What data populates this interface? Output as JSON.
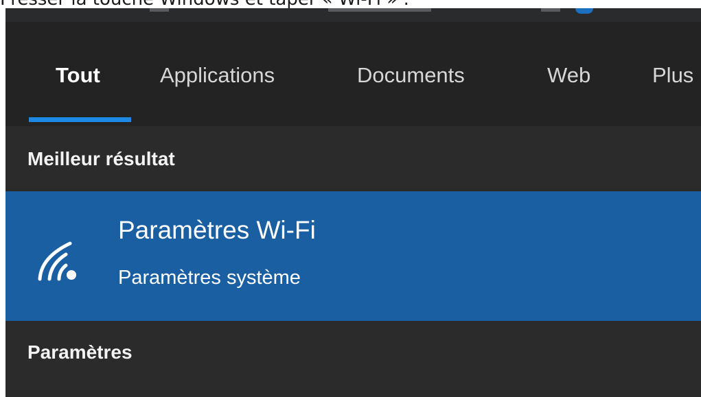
{
  "caption": "Presser la touche Windows et taper « Wi-Fi » :",
  "tabs": [
    {
      "label": "Tout",
      "active": true
    },
    {
      "label": "Applications",
      "active": false
    },
    {
      "label": "Documents",
      "active": false
    },
    {
      "label": "Web",
      "active": false
    },
    {
      "label": "Plus",
      "active": false
    }
  ],
  "best_match": {
    "heading": "Meilleur résultat",
    "icon": "wifi-icon",
    "title": "Paramètres Wi-Fi",
    "subtitle": "Paramètres système"
  },
  "settings_section": {
    "heading": "Paramètres"
  },
  "colors": {
    "panel": "#2b2b2b",
    "tabbar": "#232323",
    "accent": "#1e88e5",
    "selection": "#1b5fa3",
    "text": "#ffffff"
  }
}
